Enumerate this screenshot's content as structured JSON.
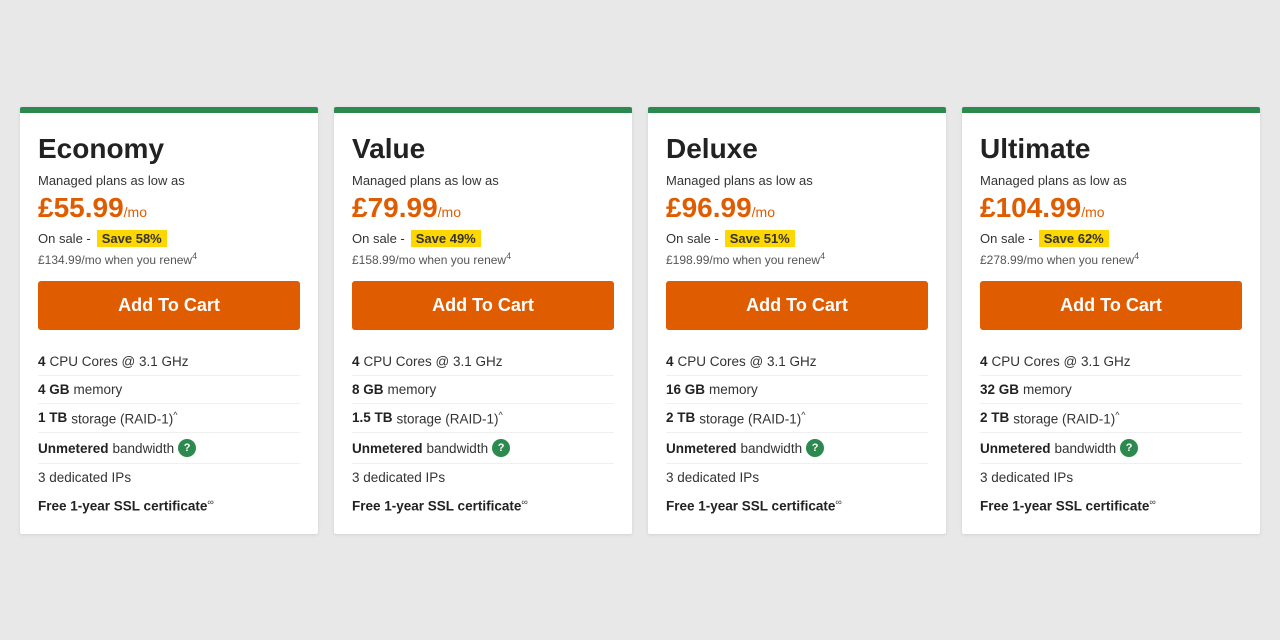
{
  "plans": [
    {
      "id": "economy",
      "name": "Economy",
      "tagline": "Managed plans as low as",
      "price": "£55.99",
      "price_per": "/mo",
      "sale_text": "On sale - ",
      "save_text": "Save 58%",
      "renew_text": "£134.99/mo when you renew",
      "renew_sup": "4",
      "cta": "Add To Cart",
      "specs": [
        {
          "bold": "4",
          "rest": " CPU Cores @ 3.1 GHz",
          "has_help": false
        },
        {
          "bold": "4 GB",
          "rest": " memory",
          "has_help": false
        },
        {
          "bold": "1 TB",
          "rest": " storage (RAID-1)",
          "sup": "^",
          "has_help": false
        },
        {
          "bold": "Unmetered",
          "rest": " bandwidth",
          "has_help": true
        }
      ],
      "dedicated_ips": "3 dedicated IPs",
      "ssl": "Free 1-year SSL certificate",
      "ssl_sup": "∞"
    },
    {
      "id": "value",
      "name": "Value",
      "tagline": "Managed plans as low as",
      "price": "£79.99",
      "price_per": "/mo",
      "sale_text": "On sale - ",
      "save_text": "Save 49%",
      "renew_text": "£158.99/mo when you renew",
      "renew_sup": "4",
      "cta": "Add To Cart",
      "specs": [
        {
          "bold": "4",
          "rest": " CPU Cores @ 3.1 GHz",
          "has_help": false
        },
        {
          "bold": "8 GB",
          "rest": " memory",
          "has_help": false
        },
        {
          "bold": "1.5 TB",
          "rest": " storage (RAID-1)",
          "sup": "^",
          "has_help": false
        },
        {
          "bold": "Unmetered",
          "rest": " bandwidth",
          "has_help": true
        }
      ],
      "dedicated_ips": "3 dedicated IPs",
      "ssl": "Free 1-year SSL certificate",
      "ssl_sup": "∞"
    },
    {
      "id": "deluxe",
      "name": "Deluxe",
      "tagline": "Managed plans as low as",
      "price": "£96.99",
      "price_per": "/mo",
      "sale_text": "On sale - ",
      "save_text": "Save 51%",
      "renew_text": "£198.99/mo when you renew",
      "renew_sup": "4",
      "cta": "Add To Cart",
      "specs": [
        {
          "bold": "4",
          "rest": " CPU Cores @ 3.1 GHz",
          "has_help": false
        },
        {
          "bold": "16 GB",
          "rest": " memory",
          "has_help": false
        },
        {
          "bold": "2 TB",
          "rest": " storage (RAID-1)",
          "sup": "^",
          "has_help": false
        },
        {
          "bold": "Unmetered",
          "rest": " bandwidth",
          "has_help": true
        }
      ],
      "dedicated_ips": "3 dedicated IPs",
      "ssl": "Free 1-year SSL certificate",
      "ssl_sup": "∞"
    },
    {
      "id": "ultimate",
      "name": "Ultimate",
      "tagline": "Managed plans as low as",
      "price": "£104.99",
      "price_per": "/mo",
      "sale_text": "On sale - ",
      "save_text": "Save 62%",
      "renew_text": "£278.99/mo when you renew",
      "renew_sup": "4",
      "cta": "Add To Cart",
      "specs": [
        {
          "bold": "4",
          "rest": " CPU Cores @ 3.1 GHz",
          "has_help": false
        },
        {
          "bold": "32 GB",
          "rest": " memory",
          "has_help": false
        },
        {
          "bold": "2 TB",
          "rest": " storage (RAID-1)",
          "sup": "^",
          "has_help": false
        },
        {
          "bold": "Unmetered",
          "rest": " bandwidth",
          "has_help": true
        }
      ],
      "dedicated_ips": "3 dedicated IPs",
      "ssl": "Free 1-year SSL certificate",
      "ssl_sup": "∞"
    }
  ]
}
